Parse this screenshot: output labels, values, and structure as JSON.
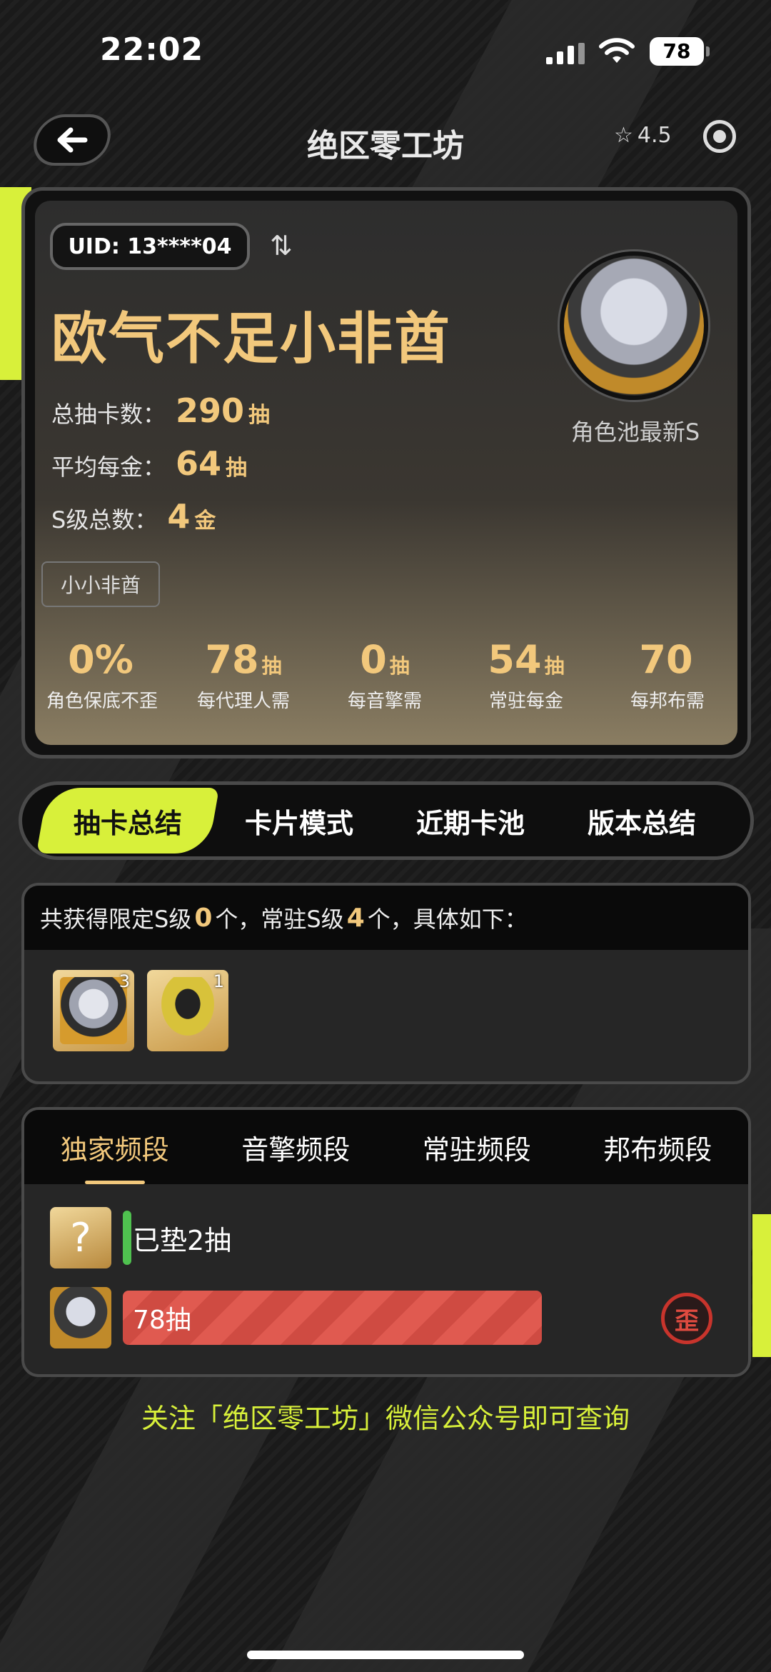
{
  "status": {
    "time": "22:02",
    "battery": "78"
  },
  "header": {
    "title": "绝区零工坊",
    "rating": "4.5"
  },
  "profile": {
    "uid": "UID: 13****04",
    "swap_glyph": "⇅",
    "nickname": "欧气不足小非酋",
    "stats": [
      {
        "label": "总抽卡数：",
        "value": "290",
        "unit": "抽"
      },
      {
        "label": "平均每金：",
        "value": "64",
        "unit": "抽"
      },
      {
        "label": "S级总数：",
        "value": "4",
        "unit": "金"
      }
    ],
    "avatar_label": "角色池最新S",
    "tag": "小小非酋",
    "metrics": [
      {
        "value": "0%",
        "unit": "",
        "label": "角色保底不歪"
      },
      {
        "value": "78",
        "unit": "抽",
        "label": "每代理人需"
      },
      {
        "value": "0",
        "unit": "抽",
        "label": "每音擎需"
      },
      {
        "value": "54",
        "unit": "抽",
        "label": "常驻每金"
      },
      {
        "value": "70",
        "unit": "",
        "label": "每邦布需"
      }
    ]
  },
  "tabs": [
    {
      "label": "抽卡总结",
      "active": true
    },
    {
      "label": "卡片模式"
    },
    {
      "label": "近期卡池"
    },
    {
      "label": "版本总结"
    }
  ],
  "summary": {
    "prefix": "共获得限定S级",
    "limited": "0",
    "mid": "个，常驻S级",
    "standard": "4",
    "suffix": "个，具体如下：",
    "chars": [
      {
        "count": "3"
      },
      {
        "count": "1"
      }
    ]
  },
  "bands": {
    "tabs": [
      "独家频段",
      "音擎频段",
      "常驻频段",
      "邦布频段"
    ],
    "pity_text": "已垫2抽",
    "pull_label": "78抽",
    "pull_fraction": 0.66,
    "stamp": "歪"
  },
  "footer": "关注「绝区零工坊」微信公众号即可查询",
  "colors": {
    "accent": "#d8f03a",
    "gold": "#f2c87c",
    "bar": "#e05a50"
  }
}
